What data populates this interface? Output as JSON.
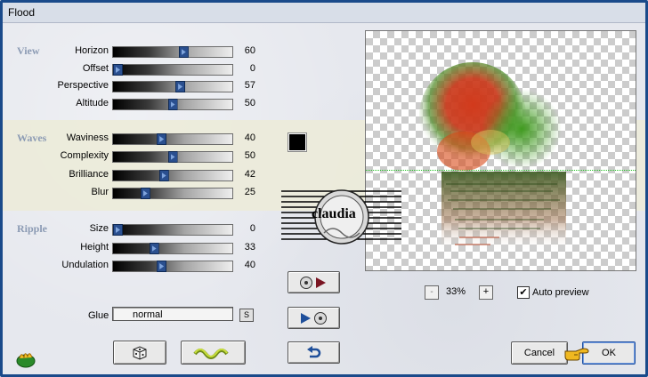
{
  "window": {
    "title": "Flood"
  },
  "sections": {
    "view": {
      "label": "View",
      "rows": [
        {
          "label": "Horizon",
          "value": "60",
          "level": 60
        },
        {
          "label": "Offset",
          "value": "0",
          "level": 0
        },
        {
          "label": "Perspective",
          "value": "57",
          "level": 57
        },
        {
          "label": "Altitude",
          "value": "50",
          "level": 50
        }
      ]
    },
    "waves": {
      "label": "Waves",
      "rows": [
        {
          "label": "Waviness",
          "value": "40",
          "level": 40
        },
        {
          "label": "Complexity",
          "value": "50",
          "level": 50
        },
        {
          "label": "Brilliance",
          "value": "42",
          "level": 42
        },
        {
          "label": "Blur",
          "value": "25",
          "level": 25
        }
      ]
    },
    "ripple": {
      "label": "Ripple",
      "rows": [
        {
          "label": "Size",
          "value": "0",
          "level": 0
        },
        {
          "label": "Height",
          "value": "33",
          "level": 33
        },
        {
          "label": "Undulation",
          "value": "40",
          "level": 40
        }
      ]
    }
  },
  "glue": {
    "label": "Glue",
    "value": "normal",
    "button": "S"
  },
  "zoom": {
    "minus": "-",
    "value": "33%",
    "plus": "+"
  },
  "auto_preview": {
    "label": "Auto preview",
    "checked": true,
    "mark": "✔"
  },
  "buttons": {
    "cancel": "Cancel",
    "ok": "OK"
  },
  "watermark": {
    "text": "claudia"
  },
  "colors": {
    "wave_color": "#000000",
    "accent": "#1a4a8a",
    "band": "#ecebd9"
  },
  "icons": [
    "app-leaf-icon",
    "dice-icon",
    "wave-icon",
    "disc-play-icon",
    "play-disc-icon",
    "undo-icon",
    "pointing-hand-icon"
  ]
}
